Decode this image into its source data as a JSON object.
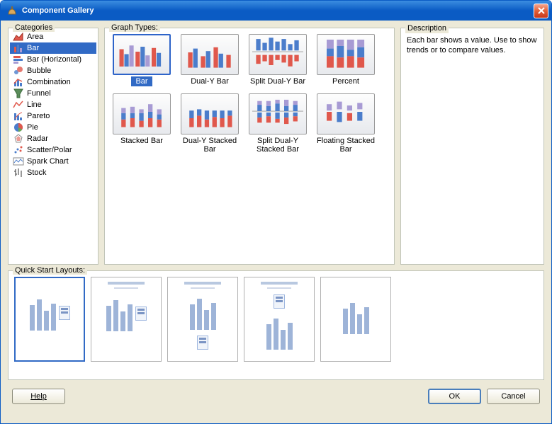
{
  "window": {
    "title": "Component Gallery"
  },
  "panels": {
    "categories": "Categories",
    "graphTypes": "Graph Types:",
    "description": "Description",
    "layouts": "Quick Start Layouts:"
  },
  "categories": [
    {
      "label": "Area",
      "icon": "area"
    },
    {
      "label": "Bar",
      "icon": "bar",
      "selected": true
    },
    {
      "label": "Bar (Horizontal)",
      "icon": "hbar"
    },
    {
      "label": "Bubble",
      "icon": "bubble"
    },
    {
      "label": "Combination",
      "icon": "combo"
    },
    {
      "label": "Funnel",
      "icon": "funnel"
    },
    {
      "label": "Line",
      "icon": "line"
    },
    {
      "label": "Pareto",
      "icon": "pareto"
    },
    {
      "label": "Pie",
      "icon": "pie"
    },
    {
      "label": "Radar",
      "icon": "radar"
    },
    {
      "label": "Scatter/Polar",
      "icon": "scatter"
    },
    {
      "label": "Spark Chart",
      "icon": "spark"
    },
    {
      "label": "Stock",
      "icon": "stock"
    }
  ],
  "graphTypes": [
    {
      "label": "Bar",
      "kind": "bar",
      "selected": true
    },
    {
      "label": "Dual-Y Bar",
      "kind": "dualy"
    },
    {
      "label": "Split Dual-Y Bar",
      "kind": "splitdualy"
    },
    {
      "label": "Percent",
      "kind": "percent"
    },
    {
      "label": "Stacked Bar",
      "kind": "stacked"
    },
    {
      "label": "Dual-Y Stacked Bar",
      "kind": "dualystacked"
    },
    {
      "label": "Split Dual-Y Stacked Bar",
      "kind": "splitdualystacked"
    },
    {
      "label": "Floating Stacked Bar",
      "kind": "floating"
    }
  ],
  "descriptionText": "Each bar shows a value. Use to show trends or to compare values.",
  "layouts": [
    {
      "kind": "legend-right",
      "selected": true
    },
    {
      "kind": "title-legend-right"
    },
    {
      "kind": "title-legend-bottom"
    },
    {
      "kind": "title-legend-top"
    },
    {
      "kind": "bare"
    }
  ],
  "buttons": {
    "help": "Help",
    "ok": "OK",
    "cancel": "Cancel"
  },
  "colors": {
    "red": "#e0584c",
    "blue": "#4b7dcb",
    "purple": "#a89bd4"
  }
}
